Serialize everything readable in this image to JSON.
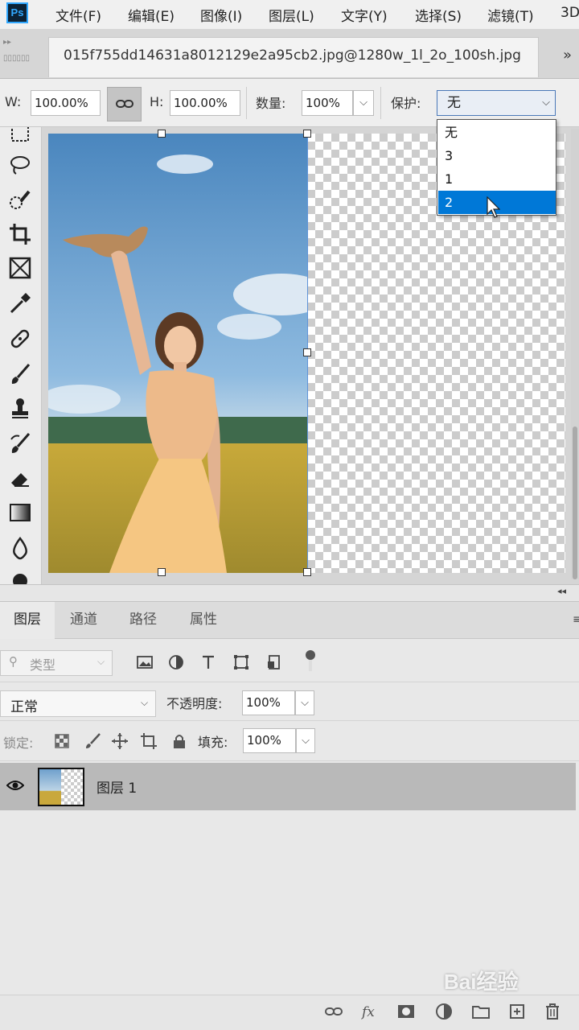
{
  "menu": {
    "logo_text": "Ps",
    "items": [
      "文件(F)",
      "编辑(E)",
      "图像(I)",
      "图层(L)",
      "文字(Y)",
      "选择(S)",
      "滤镜(T)",
      "3D"
    ]
  },
  "document_tab": {
    "title": "015f755dd14631a8012129e2a95cb2.jpg@1280w_1l_2o_100sh.jpg",
    "overflow_arrow": "»"
  },
  "options": {
    "w_label": "W:",
    "w_value": "100.00%",
    "h_label": "H:",
    "h_value": "100.00%",
    "amount_label": "数量:",
    "amount_value": "100%",
    "protect_label": "保护:",
    "protect_value": "无"
  },
  "protect_dropdown": {
    "options": [
      "无",
      "3",
      "1",
      "2"
    ],
    "highlighted": "2"
  },
  "tools": [
    "marquee-tool",
    "lasso-tool",
    "quick-selection-tool",
    "crop-tool",
    "frame-tool",
    "eyedropper-tool",
    "healing-brush-tool",
    "brush-tool",
    "clone-stamp-tool",
    "history-brush-tool",
    "eraser-tool",
    "gradient-tool",
    "blur-tool",
    "dodge-tool"
  ],
  "panels": {
    "collapse_glyph": "◂◂",
    "tabs": [
      "图层",
      "通道",
      "路径",
      "属性"
    ],
    "active_tab": "图层",
    "menu_glyph": "≡",
    "filter_kind": "类型",
    "blend_mode": "正常",
    "opacity_label": "不透明度:",
    "opacity_value": "100%",
    "lock_label": "锁定:",
    "fill_label": "填充:",
    "fill_value": "100%",
    "layer_name": "图层 1"
  },
  "bottom_icons": [
    "link-layers-icon",
    "fx-icon",
    "add-mask-icon",
    "adjustment-layer-icon",
    "new-group-icon",
    "new-layer-icon",
    "delete-layer-icon"
  ],
  "watermark": "Bai经验",
  "colors": {
    "selection_blue": "#0078d7",
    "accent_blue": "#31a8ff",
    "logo_bg": "#0c2235"
  }
}
